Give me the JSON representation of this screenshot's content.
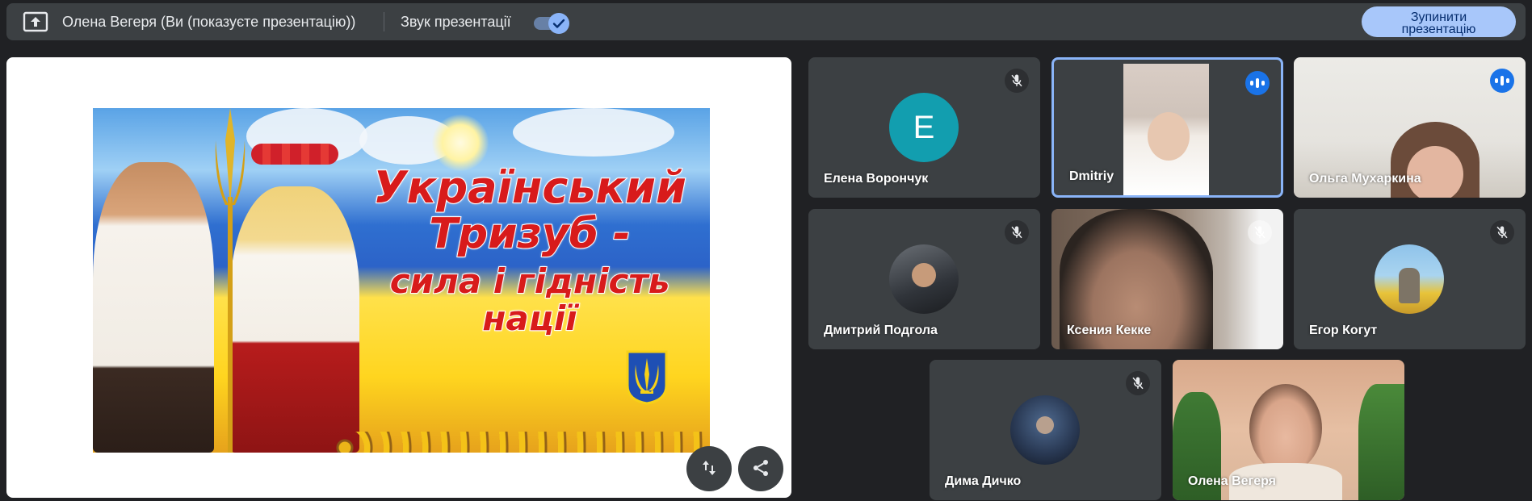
{
  "topbar": {
    "presenter_label": "Олена Вегеря (Ви (показуєте презентацію))",
    "sound_label": "Звук презентації",
    "sound_enabled": true,
    "stop_button_line1": "Зупинити",
    "stop_button_line2": "презентацію"
  },
  "slide": {
    "title_line1": "Український",
    "title_line2": "Тризуб -",
    "title_line3": "сила і гідність",
    "title_line4": "нації"
  },
  "participants": [
    {
      "name": "Елена Ворончук",
      "avatar_letter": "E",
      "muted": true,
      "speaking": false
    },
    {
      "name": "Dmitriy",
      "muted": false,
      "speaking": true,
      "active": true
    },
    {
      "name": "Ольга Мухаркина",
      "muted": false,
      "speaking": true
    },
    {
      "name": "Дмитрий Подгола",
      "muted": true,
      "speaking": false
    },
    {
      "name": "Ксения Кекке",
      "muted": true,
      "speaking": false
    },
    {
      "name": "Егор Когут",
      "muted": true,
      "speaking": false
    },
    {
      "name": "Дима Дичко",
      "muted": true,
      "speaking": false
    },
    {
      "name": "Олена Вегеря",
      "muted": false,
      "speaking": false
    }
  ],
  "colors": {
    "background": "#202124",
    "tile": "#3c4043",
    "accent": "#8ab4f8",
    "speaking": "#1a73e8",
    "stop_button": "#a8c7fa",
    "avatar_e": "#129eaf"
  },
  "icons": {
    "present": "present-to-all-icon",
    "muted": "mic-off-icon",
    "speaking": "audio-level-icon",
    "swap": "swap-icon",
    "share": "share-icon"
  }
}
